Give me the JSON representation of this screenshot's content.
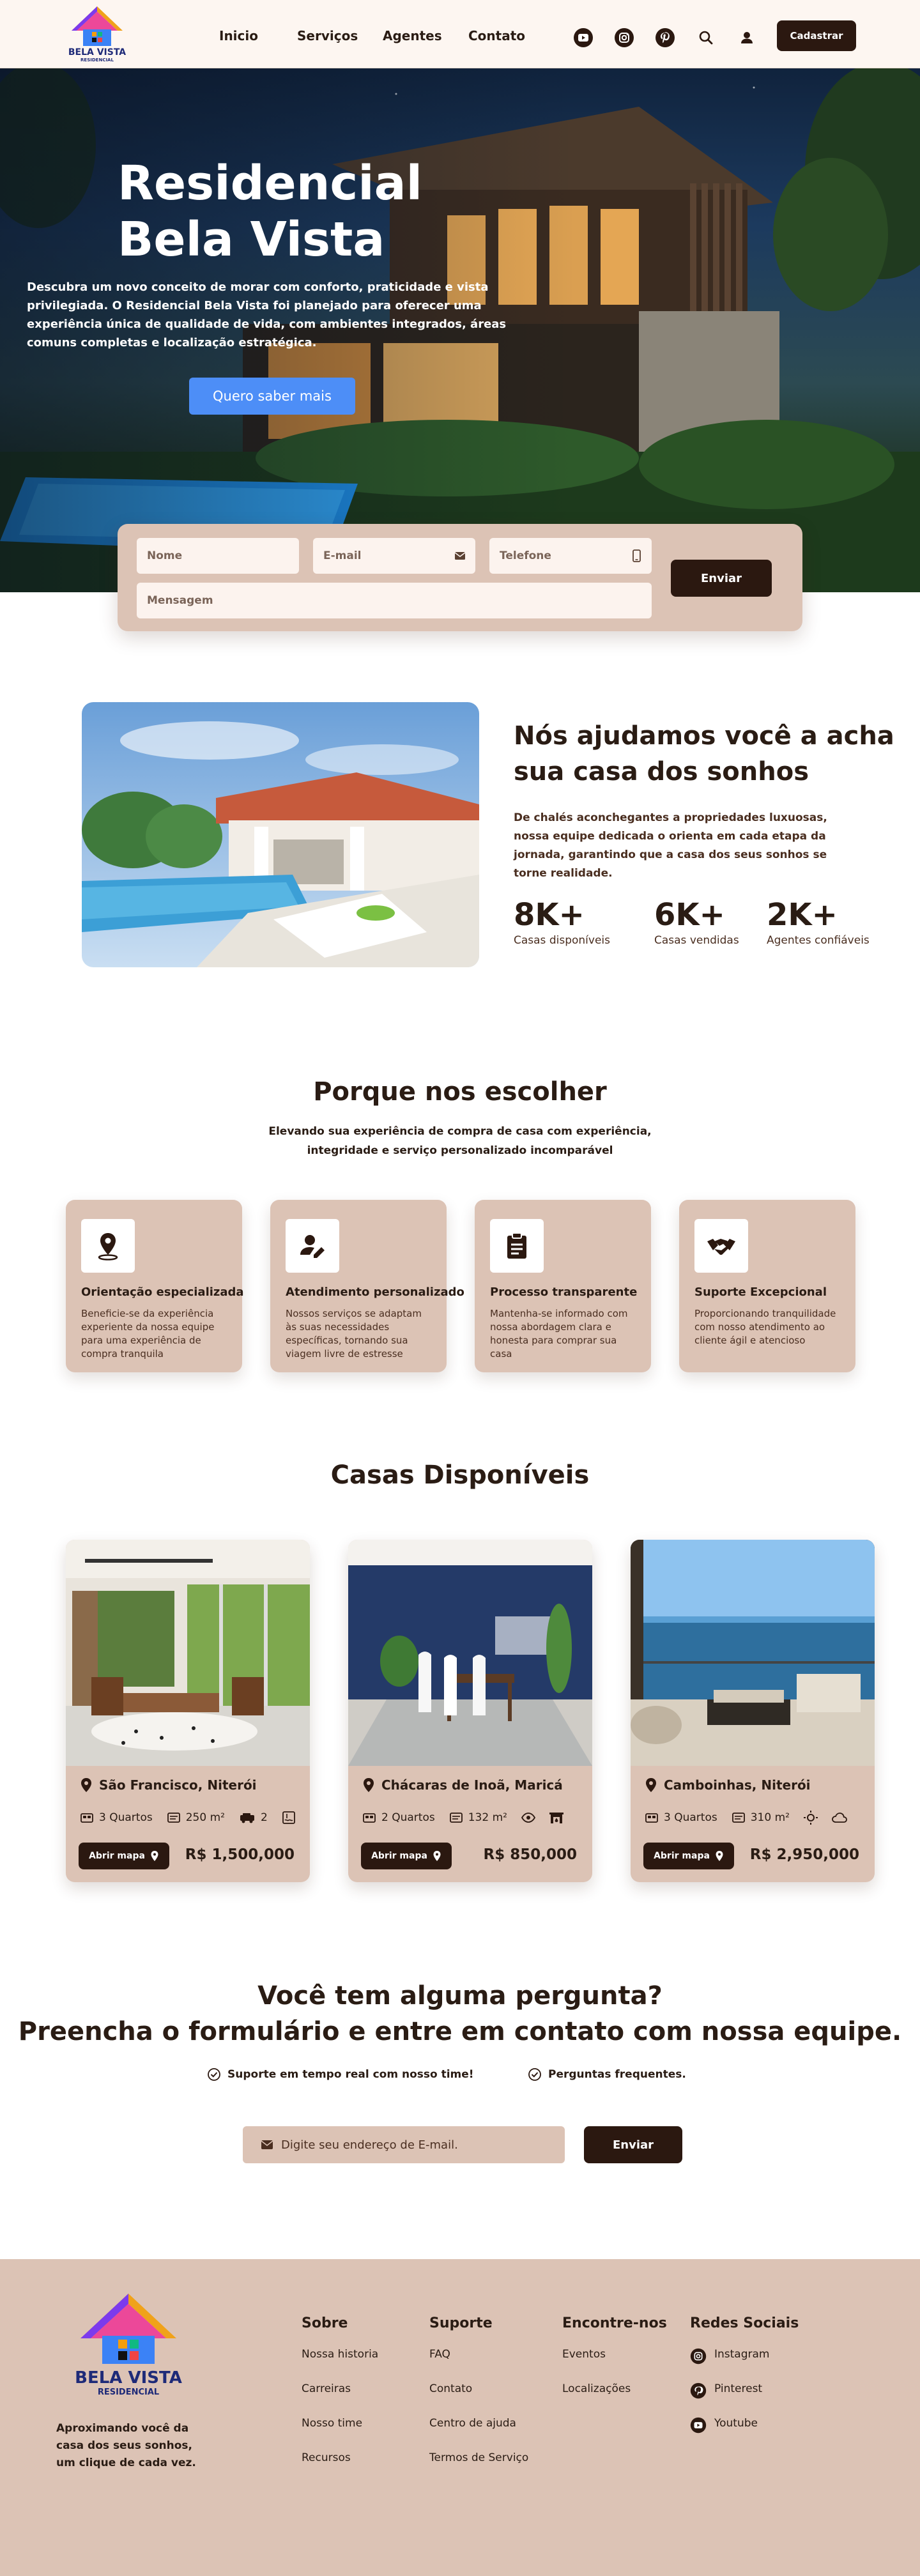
{
  "brand": {
    "name": "BELA VISTA",
    "sub": "RESIDENCIAL"
  },
  "nav": {
    "links": [
      "Inicio",
      "Serviços",
      "Agentes",
      "Contato"
    ],
    "icons": [
      "youtube-icon",
      "instagram-icon",
      "pinterest-icon",
      "search-icon",
      "user-icon"
    ],
    "cta": "Cadastrar"
  },
  "hero": {
    "title": "Residencial Bela Vista",
    "description": "Descubra um novo conceito de morar com conforto, praticidade e vista privilegiada. O Residencial Bela Vista foi planejado para oferecer uma experiência única de qualidade de vida, com ambientes integrados, áreas comuns completas e localização estratégica.",
    "cta": "Quero saber mais"
  },
  "contact_form": {
    "name_placeholder": "Nome",
    "email_placeholder": "E-mail",
    "phone_placeholder": "Telefone",
    "message_placeholder": "Mensagem",
    "submit": "Enviar"
  },
  "about": {
    "title": "Nós ajudamos você a acha sua casa dos sonhos",
    "description": "De chalés aconchegantes a propriedades luxuosas, nossa equipe dedicada o orienta em cada etapa da jornada, garantindo que a casa dos seus sonhos se torne realidade.",
    "stats": [
      {
        "value": "8K+",
        "label": "Casas disponíveis"
      },
      {
        "value": "6K+",
        "label": "Casas vendidas"
      },
      {
        "value": "2K+",
        "label": "Agentes confiáveis"
      }
    ]
  },
  "why": {
    "title": "Porque nos escolher",
    "subtitle": "Elevando sua experiência de compra de casa com experiência, integridade e serviço personalizado incomparável",
    "features": [
      {
        "icon": "map-pin-icon",
        "title": "Orientação especializada",
        "text": "Beneficie-se da experiência experiente da nossa equipe para uma experiência de compra tranquila"
      },
      {
        "icon": "user-edit-icon",
        "title": "Atendimento personalizado",
        "text": "Nossos serviços se adaptam às suas necessidades específicas, tornando sua viagem livre de estresse"
      },
      {
        "icon": "clipboard-icon",
        "title": "Processo transparente",
        "text": "Mantenha-se informado com nossa abordagem clara e honesta para comprar sua casa"
      },
      {
        "icon": "handshake-icon",
        "title": "Suporte Excepcional",
        "text": "Proporcionando tranquilidade com nosso atendimento ao cliente ágil e atencioso"
      }
    ]
  },
  "houses": {
    "title": "Casas Disponíveis",
    "map_label": "Abrir mapa",
    "items": [
      {
        "location": "São Francisco, Niterói",
        "rooms": "3 Quartos",
        "area": "250 m²",
        "garage": "2",
        "price": "R$ 1,500,000"
      },
      {
        "location": "Chácaras de Inoã, Maricá",
        "rooms": "2 Quartos",
        "area": "132 m²",
        "price": "R$ 850,000"
      },
      {
        "location": "Camboinhas, Niterói",
        "rooms": "3 Quartos",
        "area": "310 m²",
        "price": "R$ 2,950,000"
      }
    ]
  },
  "faq": {
    "title_line1": "Você tem alguma pergunta?",
    "title_line2": "Preencha o formulário e entre em contato com nossa equipe.",
    "checks": [
      "Suporte em tempo real com nosso time!",
      "Perguntas frequentes."
    ],
    "email_placeholder": "Digite seu endereço de E-mail.",
    "submit": "Enviar"
  },
  "footer": {
    "tagline": "Aproximando você da casa dos seus sonhos, um clique de cada vez.",
    "columns": [
      {
        "title": "Sobre",
        "links": [
          "Nossa historia",
          "Carreiras",
          "Nosso time",
          "Recursos"
        ]
      },
      {
        "title": "Suporte",
        "links": [
          "FAQ",
          "Contato",
          "Centro de ajuda",
          "Termos de Serviço"
        ]
      },
      {
        "title": "Encontre-nos",
        "links": [
          "Eventos",
          "Localizações"
        ]
      },
      {
        "title": "Redes Sociais",
        "links": [
          "Instagram",
          "Pinterest",
          "Youtube"
        ]
      }
    ]
  },
  "colors": {
    "dark": "#2b1810",
    "beige": "#dcc3b5",
    "cream": "#fdf6f1",
    "blue": "#4d8ef7"
  }
}
